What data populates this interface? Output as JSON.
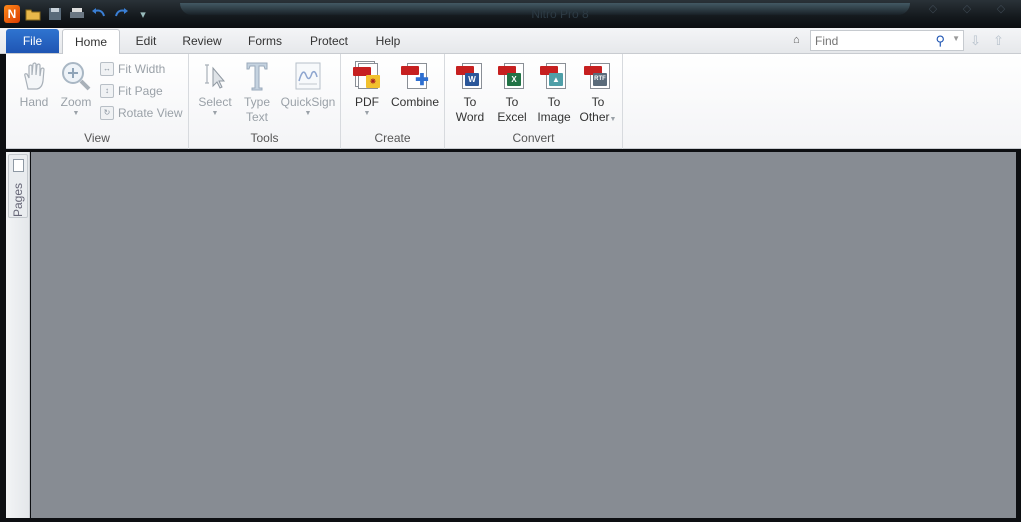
{
  "window": {
    "title": "Nitro Pro 8"
  },
  "quick_access": {
    "icons": [
      "app-logo-icon",
      "open-folder-icon",
      "save-icon",
      "print-icon",
      "undo-icon",
      "redo-icon",
      "customize-icon"
    ]
  },
  "tabs": {
    "file_label": "File",
    "items": [
      {
        "label": "Home"
      },
      {
        "label": "Edit"
      },
      {
        "label": "Review"
      },
      {
        "label": "Forms"
      },
      {
        "label": "Protect"
      },
      {
        "label": "Help"
      }
    ],
    "active": "Home"
  },
  "find": {
    "placeholder": "Find",
    "value": ""
  },
  "ribbon": {
    "view": {
      "label": "View",
      "hand": "Hand",
      "zoom": "Zoom",
      "fit_width": "Fit Width",
      "fit_page": "Fit Page",
      "rotate_view": "Rotate View"
    },
    "tools": {
      "label": "Tools",
      "select": "Select",
      "type_text_1": "Type",
      "type_text_2": "Text",
      "quicksign": "QuickSign"
    },
    "create": {
      "label": "Create",
      "pdf": "PDF",
      "combine": "Combine"
    },
    "convert": {
      "label": "Convert",
      "to_word_1": "To",
      "to_word_2": "Word",
      "to_excel_1": "To",
      "to_excel_2": "Excel",
      "to_image_1": "To",
      "to_image_2": "Image",
      "to_other_1": "To",
      "to_other_2": "Other"
    }
  },
  "sidebar": {
    "pages_label": "Pages"
  },
  "colors": {
    "file_tab": "#1f55b3",
    "workspace": "#878c93",
    "pdf_red": "#c62020",
    "word_blue": "#2b579a",
    "excel_green": "#217346"
  }
}
